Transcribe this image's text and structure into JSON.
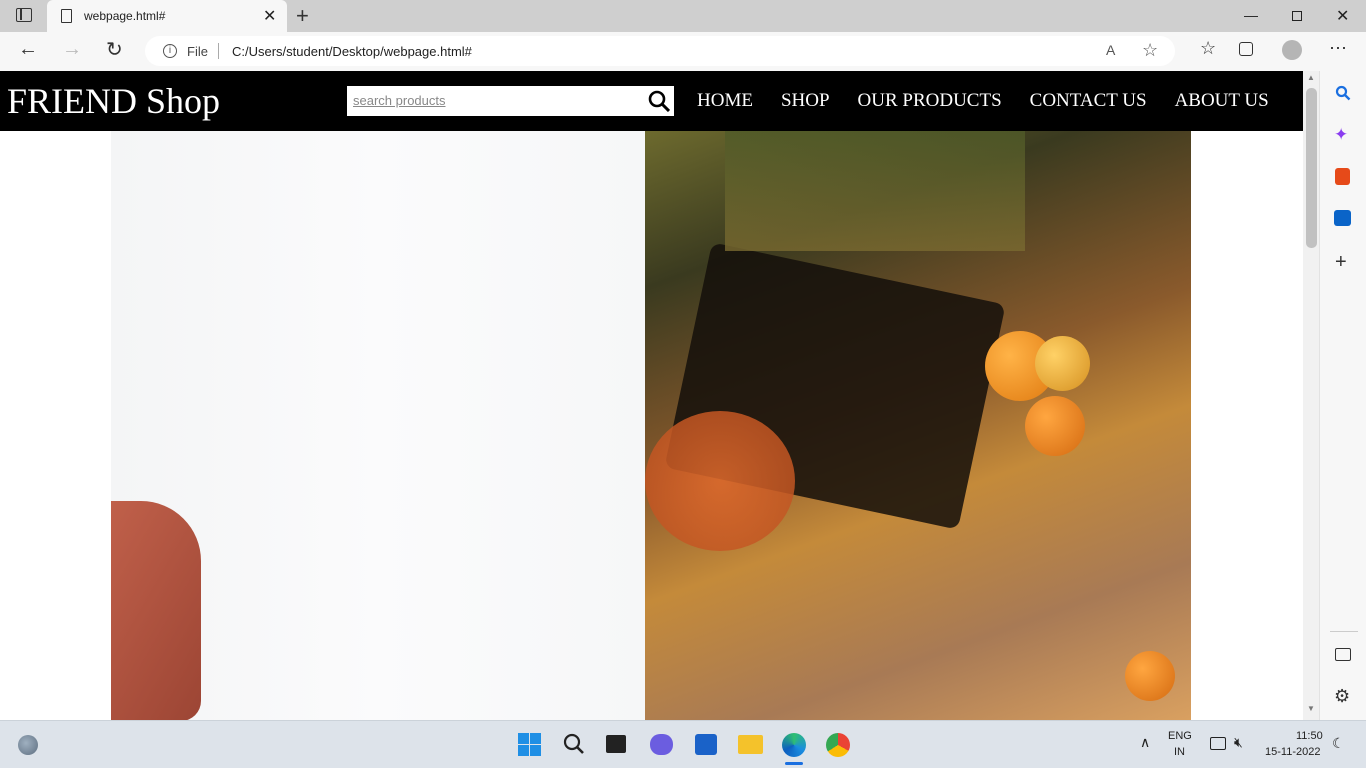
{
  "browser": {
    "tab_title": "webpage.html#",
    "address_scheme": "File",
    "address_url": "C:/Users/student/Desktop/webpage.html#"
  },
  "site": {
    "logo": "FRIEND Shop",
    "search_placeholder": "search products",
    "nav": [
      "HOME",
      "SHOP",
      "OUR PRODUCTS",
      "CONTACT US",
      "ABOUT US"
    ]
  },
  "taskbar": {
    "language": "ENG",
    "region": "IN",
    "time": "11:50",
    "date": "15-11-2022"
  },
  "icons": {
    "tab_actions": "tab-actions-icon",
    "page": "page-icon",
    "close": "close-icon",
    "new_tab": "plus-icon",
    "back": "back-arrow-icon",
    "forward": "forward-arrow-icon",
    "refresh": "refresh-icon",
    "info": "info-icon",
    "read_aloud": "read-aloud-icon",
    "add_favorite": "star-add-icon",
    "favorites": "favorites-icon",
    "collections": "collections-icon",
    "profile": "profile-icon",
    "more": "more-icon",
    "search": "search-icon"
  }
}
